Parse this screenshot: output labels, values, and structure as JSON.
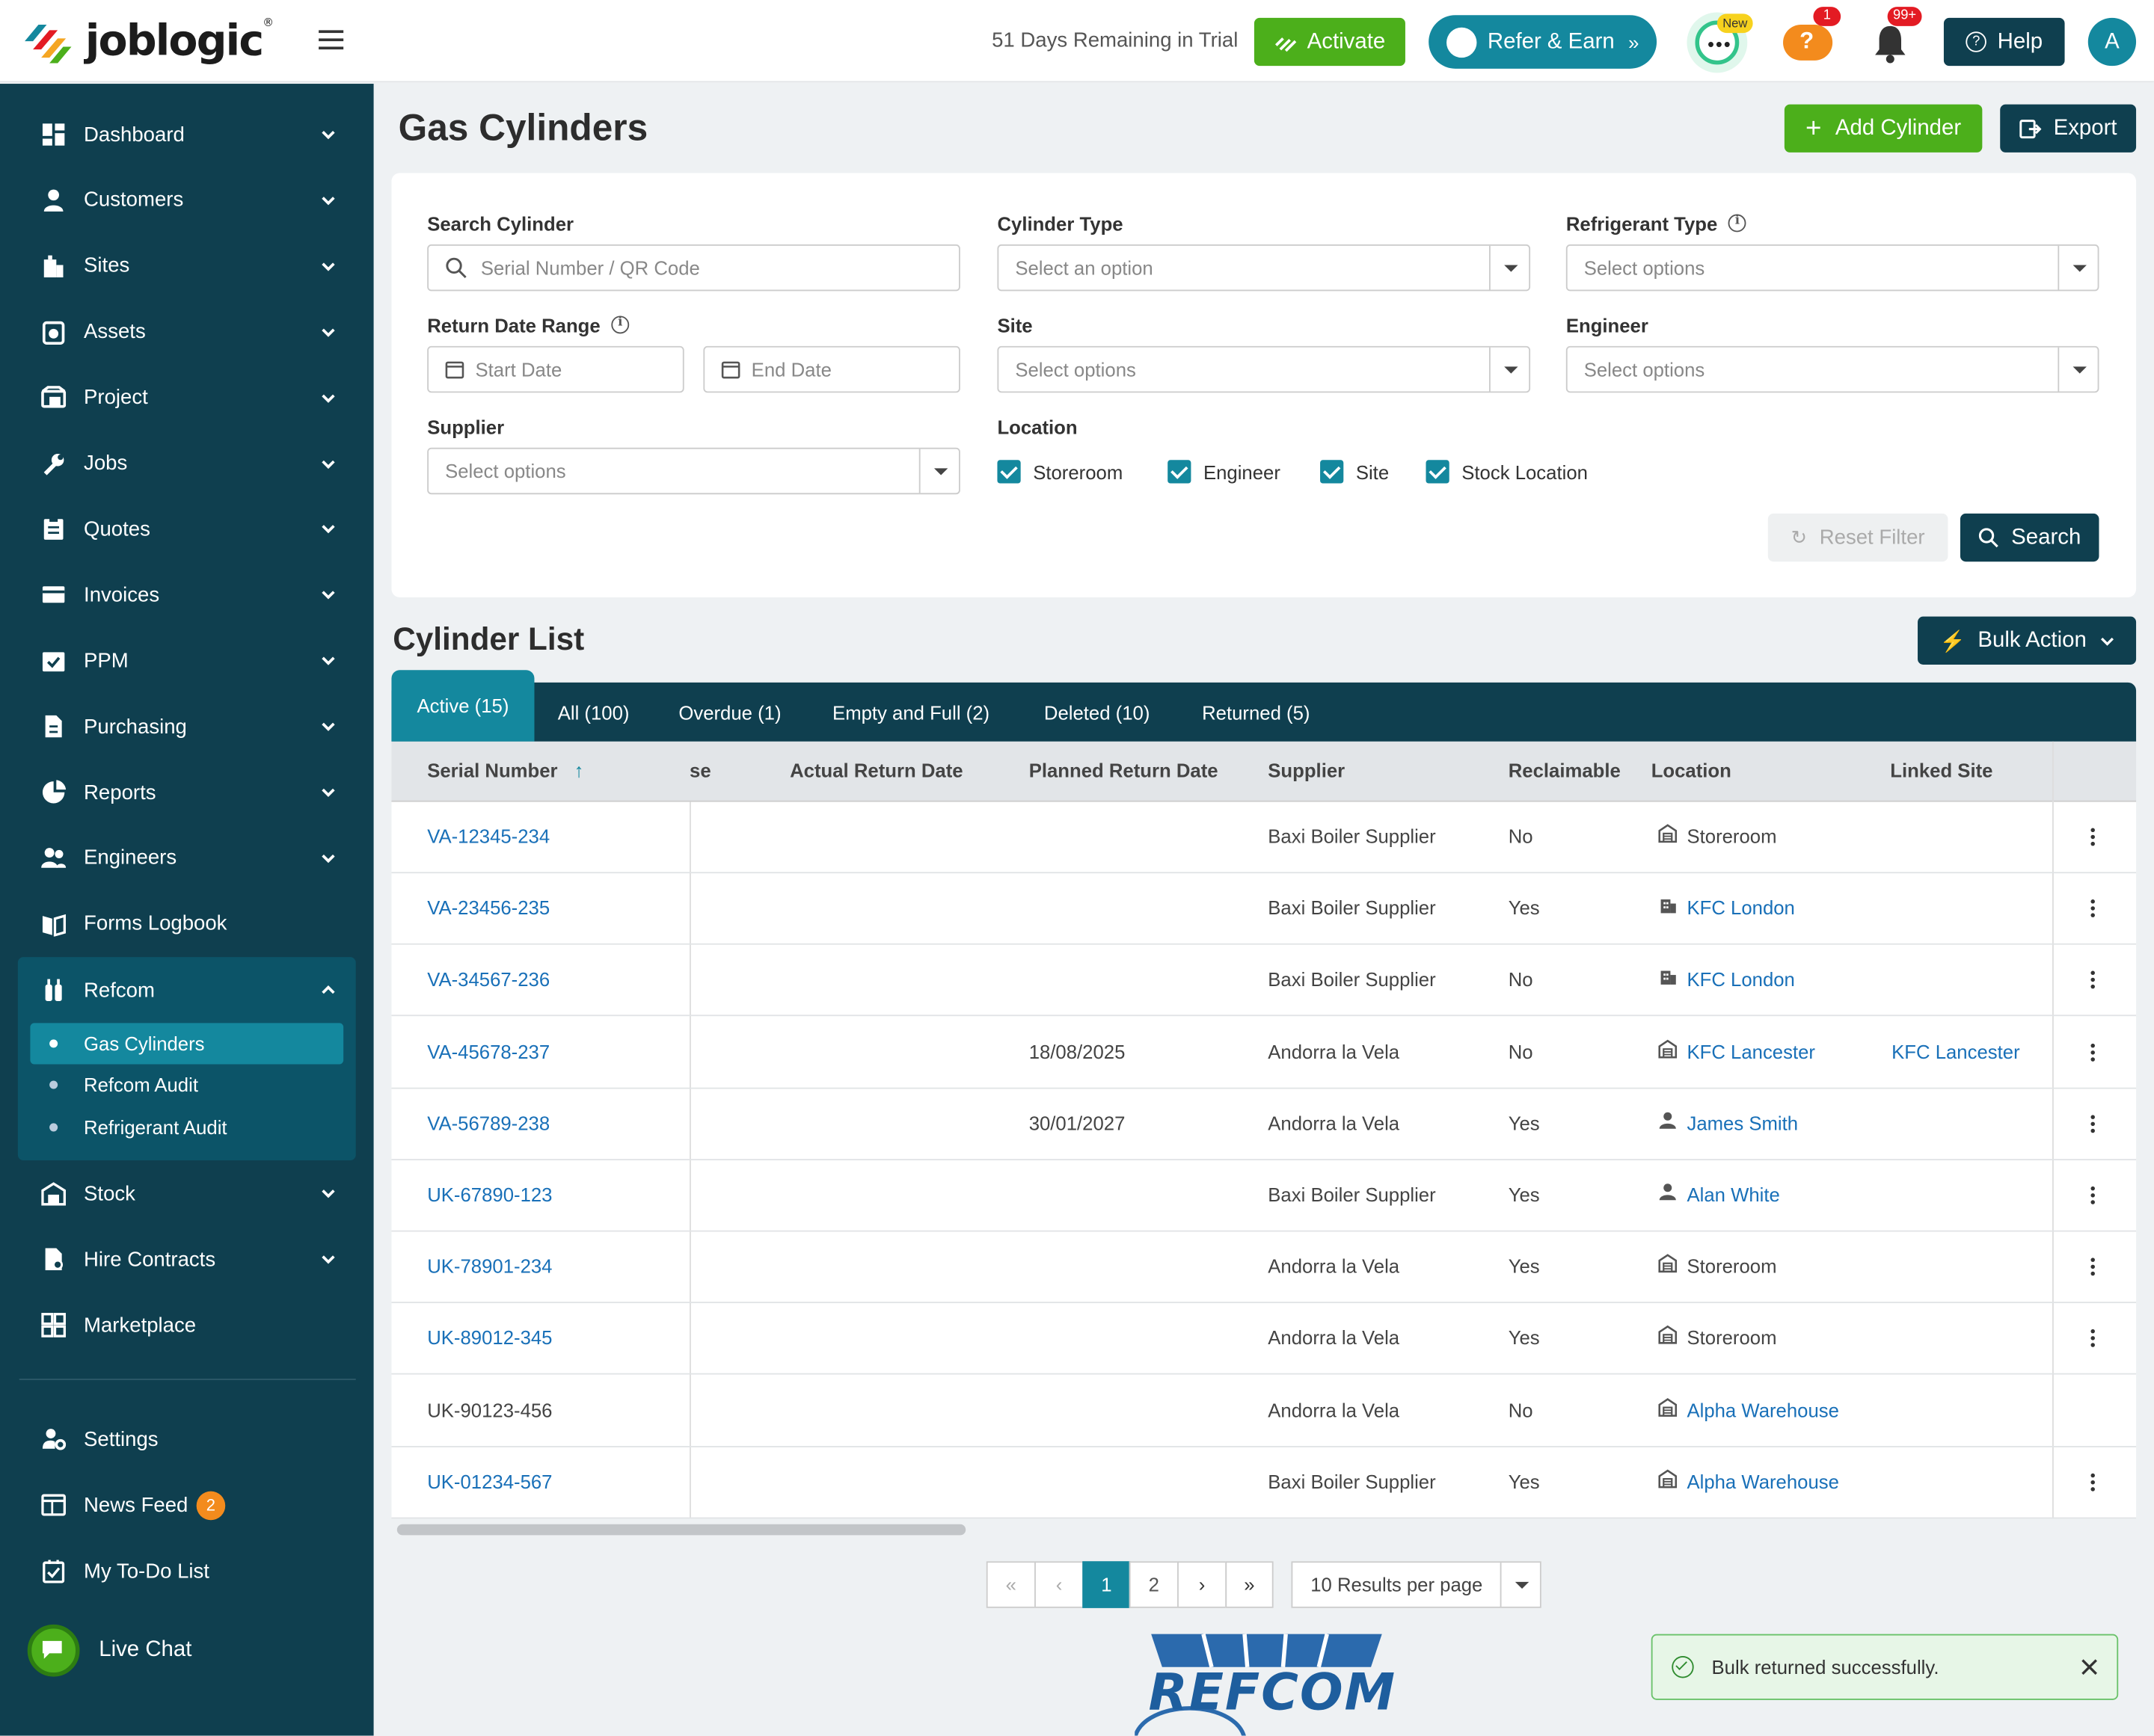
{
  "app": {
    "name": "joblogic"
  },
  "topbar": {
    "trial_text": "51 Days Remaining in Trial",
    "activate_label": "Activate",
    "refer_label": "Refer & Earn",
    "chat_badge": "New",
    "help_badge": "1",
    "notif_badge": "99+",
    "help_label": "Help",
    "avatar_initial": "A"
  },
  "sidebar": {
    "items": [
      {
        "label": "Dashboard",
        "icon": "dashboard-icon"
      },
      {
        "label": "Customers",
        "icon": "user-icon"
      },
      {
        "label": "Sites",
        "icon": "building-icon"
      },
      {
        "label": "Assets",
        "icon": "asset-icon"
      },
      {
        "label": "Project",
        "icon": "project-icon"
      },
      {
        "label": "Jobs",
        "icon": "wrench-icon"
      },
      {
        "label": "Quotes",
        "icon": "clipboard-icon"
      },
      {
        "label": "Invoices",
        "icon": "card-icon"
      },
      {
        "label": "PPM",
        "icon": "calendar-check-icon"
      },
      {
        "label": "Purchasing",
        "icon": "document-icon"
      },
      {
        "label": "Reports",
        "icon": "pie-chart-icon"
      },
      {
        "label": "Engineers",
        "icon": "users-icon"
      },
      {
        "label": "Forms Logbook",
        "icon": "book-icon"
      }
    ],
    "refcom": {
      "label": "Refcom",
      "sub_items": [
        "Gas Cylinders",
        "Refcom Audit",
        "Refrigerant Audit"
      ]
    },
    "items_after": [
      {
        "label": "Stock",
        "icon": "warehouse-icon"
      },
      {
        "label": "Hire Contracts",
        "icon": "contract-icon"
      },
      {
        "label": "Marketplace",
        "icon": "grid-icon"
      }
    ],
    "bottom": {
      "settings": "Settings",
      "news_feed": "News Feed",
      "news_badge": "2",
      "todo": "My To-Do List",
      "live_chat": "Live Chat"
    }
  },
  "page": {
    "title": "Gas Cylinders",
    "add_label": "Add Cylinder",
    "export_label": "Export"
  },
  "filters": {
    "search_label": "Search Cylinder",
    "search_placeholder": "Serial Number / QR Code",
    "cyl_type_label": "Cylinder Type",
    "cyl_type_placeholder": "Select an option",
    "refrigerant_label": "Refrigerant Type",
    "refrigerant_placeholder": "Select options",
    "return_label": "Return Date Range",
    "start_placeholder": "Start Date",
    "end_placeholder": "End Date",
    "site_label": "Site",
    "site_placeholder": "Select options",
    "engineer_label": "Engineer",
    "engineer_placeholder": "Select options",
    "supplier_label": "Supplier",
    "supplier_placeholder": "Select options",
    "location_label": "Location",
    "locations": [
      "Storeroom",
      "Engineer",
      "Site",
      "Stock Location"
    ],
    "reset_label": "Reset Filter",
    "search_btn": "Search"
  },
  "list": {
    "title": "Cylinder List",
    "bulk_label": "Bulk Action",
    "tabs": [
      "Active (15)",
      "All (100)",
      "Overdue (1)",
      "Empty and Full (2)",
      "Deleted (10)",
      "Returned (5)"
    ],
    "columns": [
      "Serial Number",
      "se",
      "Actual Return Date",
      "Planned Return Date",
      "Supplier",
      "Reclaimable",
      "Location",
      "Linked Site"
    ],
    "rows": [
      {
        "serial": "VA-12345-234",
        "planned": "",
        "supplier": "Baxi Boiler Supplier",
        "reclaimable": "No",
        "location": "Storeroom",
        "loc_type": "warehouse",
        "linked": ""
      },
      {
        "serial": "VA-23456-235",
        "planned": "",
        "supplier": "Baxi Boiler Supplier",
        "reclaimable": "Yes",
        "location": "KFC London",
        "loc_type": "building",
        "linked": ""
      },
      {
        "serial": "VA-34567-236",
        "planned": "",
        "supplier": "Baxi Boiler Supplier",
        "reclaimable": "No",
        "location": "KFC London",
        "loc_type": "building",
        "linked": ""
      },
      {
        "serial": "VA-45678-237",
        "planned": "18/08/2025",
        "supplier": "Andorra la Vela",
        "reclaimable": "No",
        "location": "KFC Lancester",
        "loc_type": "warehouse",
        "linked": "KFC Lancester"
      },
      {
        "serial": "VA-56789-238",
        "planned": "30/01/2027",
        "supplier": "Andorra la Vela",
        "reclaimable": "Yes",
        "location": "James Smith",
        "loc_type": "person",
        "linked": ""
      },
      {
        "serial": "UK-67890-123",
        "planned": "",
        "supplier": "Baxi Boiler Supplier",
        "reclaimable": "Yes",
        "location": "Alan White",
        "loc_type": "person",
        "linked": ""
      },
      {
        "serial": "UK-78901-234",
        "planned": "",
        "supplier": "Andorra la Vela",
        "reclaimable": "Yes",
        "location": "Storeroom",
        "loc_type": "warehouse",
        "linked": ""
      },
      {
        "serial": "UK-89012-345",
        "planned": "",
        "supplier": "Andorra la Vela",
        "reclaimable": "Yes",
        "location": "Storeroom",
        "loc_type": "warehouse",
        "linked": ""
      },
      {
        "serial": "UK-90123-456",
        "planned": "",
        "supplier": "Andorra la Vela",
        "reclaimable": "No",
        "location": "Alpha Warehouse",
        "loc_type": "warehouse",
        "linked": ""
      },
      {
        "serial": "UK-01234-567",
        "planned": "",
        "supplier": "Baxi Boiler Supplier",
        "reclaimable": "Yes",
        "location": "Alpha Warehouse",
        "loc_type": "warehouse",
        "linked": ""
      }
    ]
  },
  "pagination": {
    "pages": [
      "1",
      "2"
    ],
    "current": "1",
    "per_page": "10 Results per page"
  },
  "footer": {
    "brand": "REFCOM"
  },
  "toast": {
    "message": "Bulk returned successfully."
  },
  "colors": {
    "sidebar": "#0f3f4f",
    "accent": "#14889e",
    "green": "#4caf1b",
    "link": "#1970b8"
  }
}
